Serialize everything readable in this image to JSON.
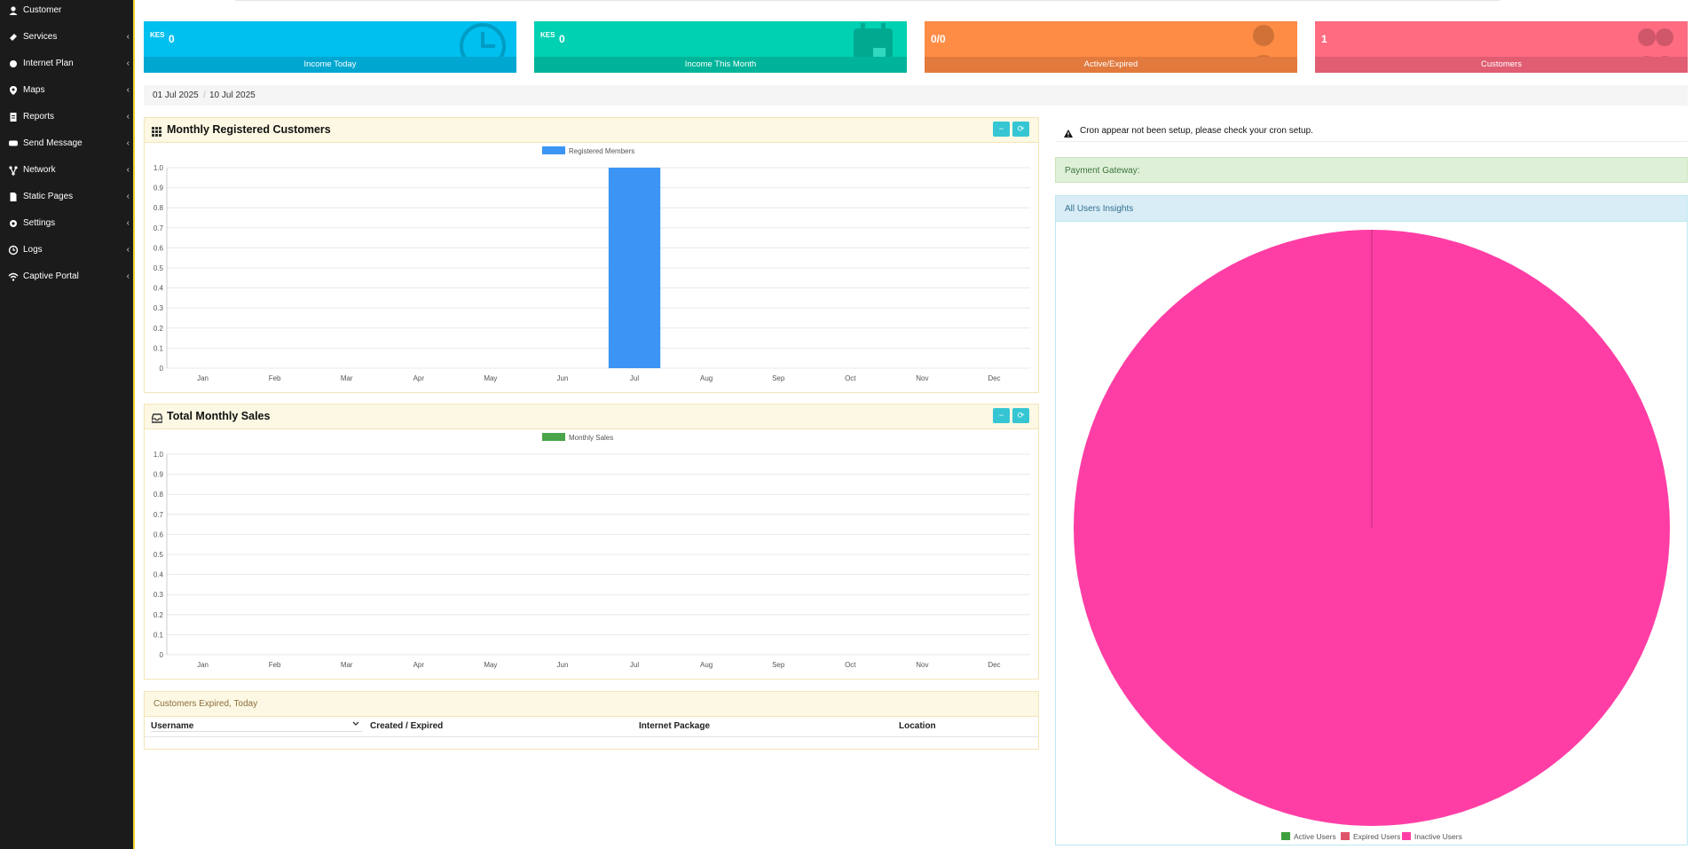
{
  "sidebar": {
    "items": [
      {
        "label": "Customer",
        "icon": "user-icon",
        "chevron": ""
      },
      {
        "label": "Services",
        "icon": "ticket-icon",
        "chevron": "‹"
      },
      {
        "label": "Internet Plan",
        "icon": "database-icon",
        "chevron": "‹"
      },
      {
        "label": "Maps",
        "icon": "map-marker-icon",
        "chevron": "‹"
      },
      {
        "label": "Reports",
        "icon": "file-text-icon",
        "chevron": "‹"
      },
      {
        "label": "Send Message",
        "icon": "comment-icon",
        "chevron": "‹"
      },
      {
        "label": "Network",
        "icon": "network-icon",
        "chevron": "‹"
      },
      {
        "label": "Static Pages",
        "icon": "file-icon",
        "chevron": "‹"
      },
      {
        "label": "Settings",
        "icon": "gear-icon",
        "chevron": "‹"
      },
      {
        "label": "Logs",
        "icon": "clock-icon",
        "chevron": "‹"
      },
      {
        "label": "Captive Portal",
        "icon": "wifi-icon",
        "chevron": "‹"
      }
    ]
  },
  "cards": [
    {
      "currency": "KES",
      "value": "0",
      "label": "Income Today",
      "color": "#00c0ef",
      "footer_color": "#00a7d0",
      "icon": "clock-icon"
    },
    {
      "currency": "KES",
      "value": "0",
      "label": "Income This Month",
      "color": "#00d1b2",
      "footer_color": "#00b49a",
      "icon": "calendar-icon"
    },
    {
      "currency": "",
      "value": "0/0",
      "label": "Active/Expired",
      "color": "#ff8c45",
      "footer_color": "#e27a3d",
      "icon": "user-icon"
    },
    {
      "currency": "",
      "value": "1",
      "label": "Customers",
      "color": "#ff6b81",
      "footer_color": "#e05d72",
      "icon": "users-icon"
    }
  ],
  "daterange": {
    "start": "01 Jul 2025",
    "end": "10 Jul 2025",
    "separator": "/"
  },
  "panels": {
    "registered": {
      "title": "Monthly Registered Customers",
      "icon": "grid-icon",
      "minimize": "−",
      "refresh": "⟳"
    },
    "sales": {
      "title": "Total Monthly Sales",
      "icon": "inbox-icon",
      "minimize": "−",
      "refresh": "⟳"
    }
  },
  "expired_table": {
    "title": "Customers Expired, Today",
    "columns": [
      "Username",
      "Created / Expired",
      "Internet Package",
      "Location"
    ]
  },
  "alerts": {
    "cron": "Cron appear not been setup, please check your cron setup.",
    "payment_gateway": "Payment Gateway:",
    "insights_title": "All Users Insights"
  },
  "chart_data": [
    {
      "type": "bar",
      "categories": [
        "Jan",
        "Feb",
        "Mar",
        "Apr",
        "May",
        "Jun",
        "Jul",
        "Aug",
        "Sep",
        "Oct",
        "Nov",
        "Dec"
      ],
      "series": [
        {
          "name": "Registered Members",
          "values": [
            0,
            0,
            0,
            0,
            0,
            0,
            1,
            0,
            0,
            0,
            0,
            0
          ],
          "color": "#3c95f5"
        }
      ],
      "yticks": [
        "1.0",
        "0.9",
        "0.8",
        "0.7",
        "0.6",
        "0.5",
        "0.4",
        "0.3",
        "0.2",
        "0.1",
        "0"
      ],
      "ylim": [
        0,
        1
      ],
      "grid": true,
      "legend": "top"
    },
    {
      "type": "bar",
      "categories": [
        "Jan",
        "Feb",
        "Mar",
        "Apr",
        "May",
        "Jun",
        "Jul",
        "Aug",
        "Sep",
        "Oct",
        "Nov",
        "Dec"
      ],
      "series": [
        {
          "name": "Monthly Sales",
          "values": [
            0,
            0,
            0,
            0,
            0,
            0,
            0,
            0,
            0,
            0,
            0,
            0
          ],
          "color": "#4aa54a"
        }
      ],
      "yticks": [
        "1.0",
        "0.9",
        "0.8",
        "0.7",
        "0.6",
        "0.5",
        "0.4",
        "0.3",
        "0.2",
        "0.1",
        "0"
      ],
      "ylim": [
        0,
        1
      ],
      "grid": true,
      "legend": "top"
    },
    {
      "type": "pie",
      "labels": [
        "Active Users",
        "Expired Users",
        "Inactive Users"
      ],
      "values": [
        0,
        0,
        1
      ],
      "colors": [
        "#3e9f3e",
        "#e0546a",
        "#ff3ea5"
      ],
      "legend": "bottom"
    }
  ]
}
